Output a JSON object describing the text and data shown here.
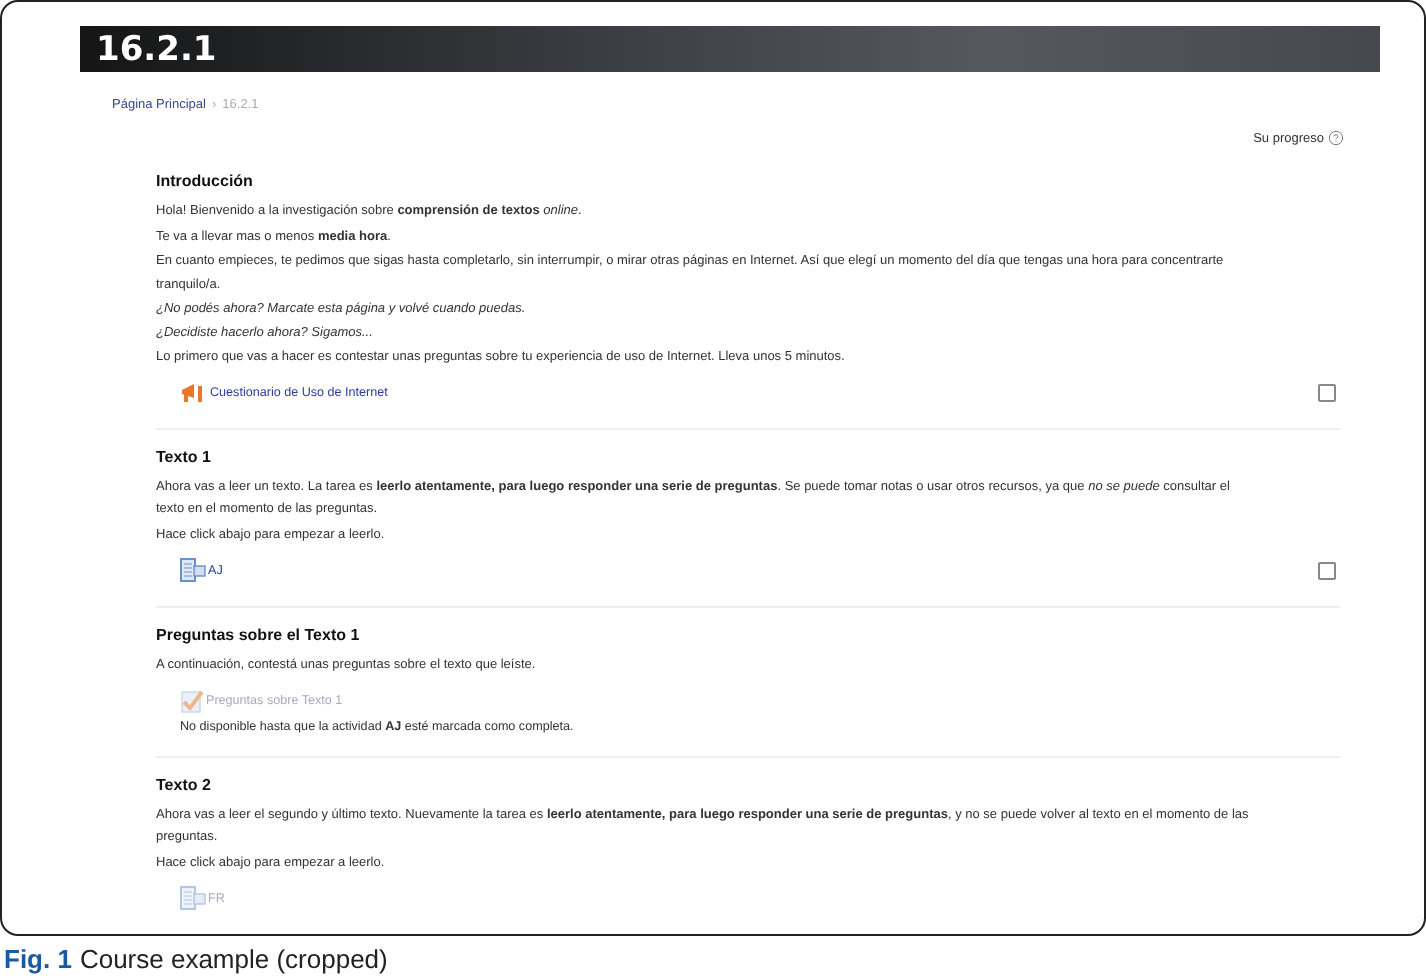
{
  "header": {
    "title": "16.2.1"
  },
  "breadcrumb": {
    "separator": "›",
    "items": [
      {
        "label": "Página Principal",
        "link": true
      },
      {
        "label": "16.2.1",
        "link": false
      }
    ]
  },
  "progress": {
    "label": "Su progreso"
  },
  "sections": [
    {
      "title": "Introducción",
      "paragraphs": [
        "Hola! Bienvenido a la investigación sobre **comprensión de textos** *online*.",
        "Te va a llevar mas o menos **media hora**.",
        "En cuanto empieces, te pedimos que sigas hasta completarlo, sin interrumpir, o mirar otras páginas en Internet. Así que elegí un momento del día que tengas una hora para concentrarte tranquilo/a.",
        "*¿No podés ahora? Marcate esta página y volvé cuando puedas.*\n*¿Decidiste hacerlo ahora? Sigamos...*",
        "Lo primero que vas a hacer es contestar unas preguntas sobre tu experiencia de uso de Internet. Lleva unos 5 minutos."
      ],
      "activity": {
        "kind": "questionnaire",
        "label": "Cuestionario de Uso de Internet",
        "disabled": false,
        "completion": {
          "checked": false
        }
      }
    },
    {
      "title": "Texto 1",
      "paragraphs": [
        "Ahora vas a leer un texto. La tarea es **leerlo atentamente, para luego responder una serie de preguntas**. Se puede tomar notas o usar otros recursos, ya que *no se puede* consultar el texto en el momento de las preguntas.",
        "Hace click abajo para empezar a leerlo."
      ],
      "activity": {
        "kind": "page",
        "label": "AJ",
        "disabled": false,
        "completion": {
          "checked": false
        }
      }
    },
    {
      "title": "Preguntas sobre el Texto 1",
      "paragraphs": [
        "A continuación, contestá unas preguntas sobre el texto que leíste."
      ],
      "activity": {
        "kind": "quiz",
        "label": "Preguntas sobre Texto 1",
        "disabled": true,
        "restriction": "No disponible hasta que la actividad **AJ** esté marcada como completa."
      }
    },
    {
      "title": "Texto 2",
      "paragraphs": [
        "Ahora vas a leer el segundo y último texto. Nuevamente la tarea es **leerlo atentamente, para luego responder una serie de preguntas**, y no se puede volver al texto en el momento de las preguntas.",
        "Hace click abajo para empezar a leerlo."
      ],
      "activity": {
        "kind": "page",
        "label": "FR",
        "disabled": true
      }
    }
  ],
  "caption": {
    "label": "Fig. 1",
    "text": "Course example (cropped)"
  }
}
